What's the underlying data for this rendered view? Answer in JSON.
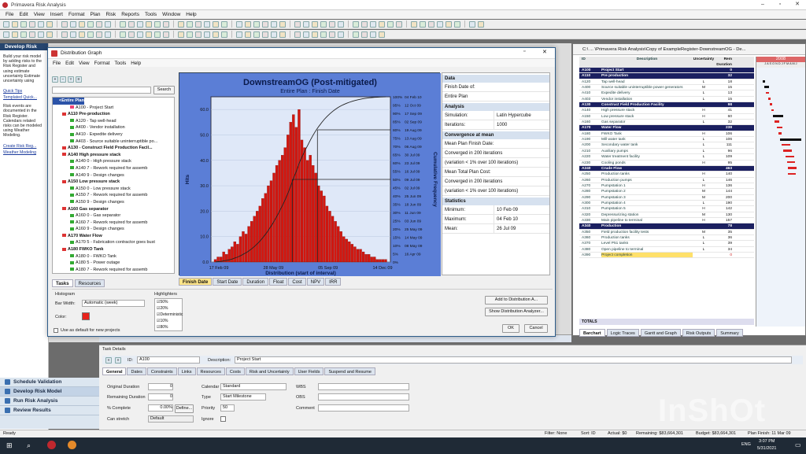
{
  "app": {
    "title": "Primavera Risk Analysis",
    "menu": [
      "File",
      "Edit",
      "View",
      "Insert",
      "Format",
      "Plan",
      "Risk",
      "Reports",
      "Tools",
      "Window",
      "Help"
    ]
  },
  "left_pane": {
    "title": "Develop Risk Model",
    "text": "Build your risk model by adding risks to the Risk Register and using estimate uncertainty Estimate uncertainty using",
    "text2": "Risk events are documented in the Risk Register. Calendars related risks can be modeled using Weather Modeling.",
    "links": [
      "Quick Tips",
      "Templated Quick...",
      "Create Risk Reg...",
      "Weather Modeling"
    ]
  },
  "bottom_nav": [
    "Schedule Validation",
    "Develop Risk Model",
    "Run Risk Analysis",
    "Review Results"
  ],
  "dialog": {
    "title": "Distribution Graph",
    "menu": [
      "File",
      "Edit",
      "View",
      "Format",
      "Tools",
      "Help"
    ],
    "search_label": "Search",
    "tree": [
      {
        "t": "<Entire Plan>",
        "b": true,
        "m": ""
      },
      {
        "t": "A100 - Project Start",
        "b": false,
        "m": "o"
      },
      {
        "t": "A110  Pre-production",
        "b": true,
        "m": "r"
      },
      {
        "t": "A120 - Tap  well-head",
        "b": false,
        "m": "g"
      },
      {
        "t": "A400 - Vendor installation",
        "b": false,
        "m": "g"
      },
      {
        "t": "A410 - Expedite delivery",
        "b": false,
        "m": "g"
      },
      {
        "t": "A403 - Source suitable uninterruptible po...",
        "b": false,
        "m": "g"
      },
      {
        "t": "A130  - Construct Field Production Facil...",
        "b": true,
        "m": "r"
      },
      {
        "t": "A140  High pressure stack",
        "b": true,
        "m": "r"
      },
      {
        "t": "A140 0 - High pressure stack",
        "b": false,
        "m": "g"
      },
      {
        "t": "A140 7 - Rework required for assemb",
        "b": false,
        "m": "g"
      },
      {
        "t": "A140 9 - Design changes",
        "b": false,
        "m": "g"
      },
      {
        "t": "A150  Low pressure stack",
        "b": true,
        "m": "r"
      },
      {
        "t": "A150 0 - Low pressure stack",
        "b": false,
        "m": "g"
      },
      {
        "t": "A150 7 - Rework required for assemb",
        "b": false,
        "m": "g"
      },
      {
        "t": "A150 9 - Design changes",
        "b": false,
        "m": "g"
      },
      {
        "t": "A160  Gas separator",
        "b": true,
        "m": "r"
      },
      {
        "t": "A160 0 - Gas separator",
        "b": false,
        "m": "g"
      },
      {
        "t": "A160 7 - Rework required for assemb",
        "b": false,
        "m": "g"
      },
      {
        "t": "A160 9 - Design changes",
        "b": false,
        "m": "g"
      },
      {
        "t": "A170  Water Flow",
        "b": true,
        "m": "r"
      },
      {
        "t": "A170 5 - Fabrication contractor goes bust",
        "b": false,
        "m": "g"
      },
      {
        "t": "A180  FWKO Tank",
        "b": true,
        "m": "r"
      },
      {
        "t": "A180 0 - FWKO Tank",
        "b": false,
        "m": "g"
      },
      {
        "t": "A180 5 - Power outage",
        "b": false,
        "m": "g"
      },
      {
        "t": "A180 7 - Rework required for assemb",
        "b": false,
        "m": "g"
      }
    ],
    "tree_tabs": [
      "Tasks",
      "Resources"
    ],
    "chart_tabs": [
      "Finish Date",
      "Start Date",
      "Duration",
      "Float",
      "Cost",
      "NPV",
      "IRR"
    ],
    "options": {
      "histogram": "Histogram",
      "bar_width_label": "Bar Width:",
      "bar_width": "Automatic (week)",
      "color_label": "Color:",
      "default_label": "Use as default for new projects",
      "highlighters": "Highlighters",
      "hl": [
        "50%",
        "20%",
        "Deterministic",
        "10%",
        "80%"
      ]
    },
    "buttons": {
      "add": "Add to Distribution A...",
      "show": "Show Distribution Analyzer...",
      "ok": "OK",
      "cancel": "Cancel"
    },
    "data_pane": {
      "sections": [
        {
          "h": "Data",
          "rows": [
            [
              "Finish Date of:",
              ""
            ],
            [
              "Entire Plan",
              ""
            ]
          ]
        },
        {
          "h": "Analysis",
          "rows": [
            [
              "Simulation:",
              "Latin Hypercube"
            ],
            [
              "Iterations:",
              "1000"
            ]
          ]
        },
        {
          "h": "Convergence at mean",
          "rows": [
            [
              "Mean Plan Finish Date:",
              ""
            ],
            [
              "Converged in 200 iterations",
              ""
            ],
            [
              "(variation < 1% over 100 iterations)",
              ""
            ],
            [
              "Mean Total Plan Cost:",
              ""
            ],
            [
              "Converged in 200 iterations",
              ""
            ],
            [
              "(variation < 1% over 100 iterations)",
              ""
            ]
          ]
        },
        {
          "h": "Statistics",
          "rows": [
            [
              "Minimum:",
              "10 Feb 09"
            ],
            [
              "Maximum:",
              "04 Feb 10"
            ],
            [
              "Mean:",
              "26 Jul 09"
            ]
          ]
        }
      ]
    }
  },
  "chart_data": {
    "type": "bar",
    "title": "DownstreamOG (Post-mitigated)",
    "subtitle": "Entire Plan : Finish Date",
    "xlabel": "Distribution (start of interval)",
    "ylabel": "Hits",
    "y2label": "Cumulative Frequency",
    "x_ticks": [
      "17 Feb 09",
      "28 May 09",
      "05 Sep 09",
      "14 Dec 09"
    ],
    "y_ticks": [
      0,
      10,
      20,
      30,
      40,
      50,
      60
    ],
    "ylim": [
      0,
      65
    ],
    "right_ticks": [
      [
        "0%",
        ""
      ],
      [
        "5%",
        "16 Apr 09"
      ],
      [
        "10%",
        "08 May 09"
      ],
      [
        "15%",
        "14 May 09"
      ],
      [
        "20%",
        "25 May 09"
      ],
      [
        "25%",
        "03 Jun 09"
      ],
      [
        "30%",
        "11 Jun 09"
      ],
      [
        "35%",
        "18 Jun 09"
      ],
      [
        "40%",
        "25 Jun 09"
      ],
      [
        "45%",
        "02 Jul 09"
      ],
      [
        "50%",
        "09 Jul 09"
      ],
      [
        "55%",
        "16 Jul 09"
      ],
      [
        "60%",
        "23 Jul 09"
      ],
      [
        "65%",
        "30 Jul 09"
      ],
      [
        "70%",
        "06 Aug 09"
      ],
      [
        "75%",
        "13 Aug 09"
      ],
      [
        "80%",
        "19 Aug 09"
      ],
      [
        "85%",
        "02 Sep 09"
      ],
      [
        "90%",
        "17 Sep 09"
      ],
      [
        "95%",
        "12 Oct 09"
      ],
      [
        "100%",
        "04 Feb 10"
      ]
    ],
    "values": [
      1,
      2,
      2,
      4,
      3,
      5,
      6,
      8,
      7,
      10,
      12,
      11,
      14,
      16,
      18,
      20,
      22,
      25,
      27,
      30,
      32,
      35,
      38,
      40,
      42,
      45,
      50,
      55,
      58,
      53,
      60,
      48,
      45,
      40,
      42,
      38,
      35,
      30,
      28,
      26,
      22,
      20,
      18,
      16,
      14,
      12,
      10,
      9,
      8,
      7,
      6,
      5,
      5,
      4,
      3,
      3,
      2,
      2,
      1,
      1,
      1,
      1
    ]
  },
  "right_window": {
    "title": "C:\\ ... \\Primavera Risk Analysis\\Copy of ExampleRegister-DownstreamOG - De...",
    "cols": [
      "ID",
      "Description",
      "Uncertainty",
      "Rem Duration"
    ],
    "year": "2008",
    "months": "J A S O N D J F M A M J",
    "rows": [
      [
        "A100",
        "Project Start",
        "",
        "0",
        "hd"
      ],
      [
        "A110",
        "Pre production",
        "",
        "32",
        "hd"
      ],
      [
        "A120",
        "Tap  well-head",
        "L",
        "18",
        ""
      ],
      [
        "A400",
        "Source suitable uninterruptible power generators",
        "M",
        "15",
        ""
      ],
      [
        "A410",
        "Expedite delivery",
        "L",
        "13",
        ""
      ],
      [
        "A403",
        "Vendor installation",
        "L",
        "15",
        ""
      ],
      [
        "A130",
        "Construct Field Production Facility",
        "",
        "98",
        "hd"
      ],
      [
        "A140",
        "High pressure stack",
        "H",
        "41",
        ""
      ],
      [
        "A150",
        "Low pressure stack",
        "H",
        "60",
        ""
      ],
      [
        "A160",
        "Gas separator",
        "L",
        "32",
        ""
      ],
      [
        "A170",
        "Water Flow",
        "",
        "238",
        "hd"
      ],
      [
        "A180",
        "FWKO Tank",
        "H",
        "106",
        ""
      ],
      [
        "A190",
        "Mill water tank",
        "L",
        "106",
        ""
      ],
      [
        "A200",
        "Secondary water tank",
        "L",
        "111",
        ""
      ],
      [
        "A210",
        "Auxiliary pumps",
        "L",
        "96",
        ""
      ],
      [
        "A220",
        "Water treatment facility",
        "L",
        "109",
        ""
      ],
      [
        "A230",
        "Cooling ponds",
        "H",
        "95",
        ""
      ],
      [
        "A240",
        "Crude Flow",
        "",
        "463",
        "hd"
      ],
      [
        "A250",
        "Production tanks",
        "H",
        "140",
        ""
      ],
      [
        "A260",
        "Production pumps",
        "L",
        "146",
        ""
      ],
      [
        "A270",
        "Pumpstation 1",
        "H",
        "136",
        ""
      ],
      [
        "A280",
        "Pumpstation 2",
        "M",
        "144",
        ""
      ],
      [
        "A290",
        "Pumpstation 3",
        "M",
        "200",
        ""
      ],
      [
        "A300",
        "Pumpstation 4",
        "L",
        "190",
        ""
      ],
      [
        "A310",
        "Pumpstation 5",
        "H",
        "142",
        ""
      ],
      [
        "A320",
        "Depressurizing station",
        "M",
        "130",
        ""
      ],
      [
        "A330",
        "Main pipeline to terminal",
        "H",
        "157",
        ""
      ],
      [
        "A340",
        "Production",
        "",
        "78",
        "hd"
      ],
      [
        "A350",
        "Field production facility tests",
        "M",
        "35",
        ""
      ],
      [
        "A360",
        "Production tanks",
        "L",
        "36",
        ""
      ],
      [
        "A370",
        "Level P51 tanks",
        "L",
        "39",
        ""
      ],
      [
        "A380",
        "Open pipeline to terminal",
        "L",
        "34",
        ""
      ],
      [
        "A390",
        "Project completion",
        "",
        "0",
        "sel"
      ]
    ],
    "totals": "TOTALS",
    "tabs": [
      "Barchart",
      "Logic Traces",
      "Gantt and Graph",
      "Risk Outputs",
      "Summary"
    ]
  },
  "task_details": {
    "title": "Task Details",
    "id_label": "ID:",
    "id": "A100",
    "desc_label": "Description:",
    "desc": "Project Start",
    "tabs": [
      "General",
      "Dates",
      "Constraints",
      "Links",
      "Resources",
      "Costs",
      "Risk and Uncertainty",
      "User Fields",
      "Suspend and Resume"
    ],
    "orig_label": "Original Duration",
    "orig": "0",
    "rem_label": "Remaining Duration",
    "rem": "0",
    "pct_label": "% Complete",
    "pct": "0.00%",
    "define": "Define...",
    "stretch_label": "Can stretch",
    "stretch": "Default",
    "cal_label": "Calendar",
    "cal": "Standard",
    "type_label": "Type",
    "type": "Start Milestone",
    "prio_label": "Priority",
    "prio": "50",
    "ignore_label": "Ignore",
    "wbs_label": "WBS",
    "obs_label": "OBS",
    "comment_label": "Comment"
  },
  "status": {
    "ready": "Ready",
    "filter": "Filter: None",
    "sort": "Sort: ID",
    "actual": "Actual: $0",
    "remaining": "Remaining: $83,664,301",
    "budget": "Budget: $83,664,301",
    "finish": "Plan Finish: 11 Mar 09"
  },
  "taskbar": {
    "lang": "ENG",
    "time": "3:07 PM",
    "date": "5/31/2021"
  },
  "watermark": "InShOt"
}
